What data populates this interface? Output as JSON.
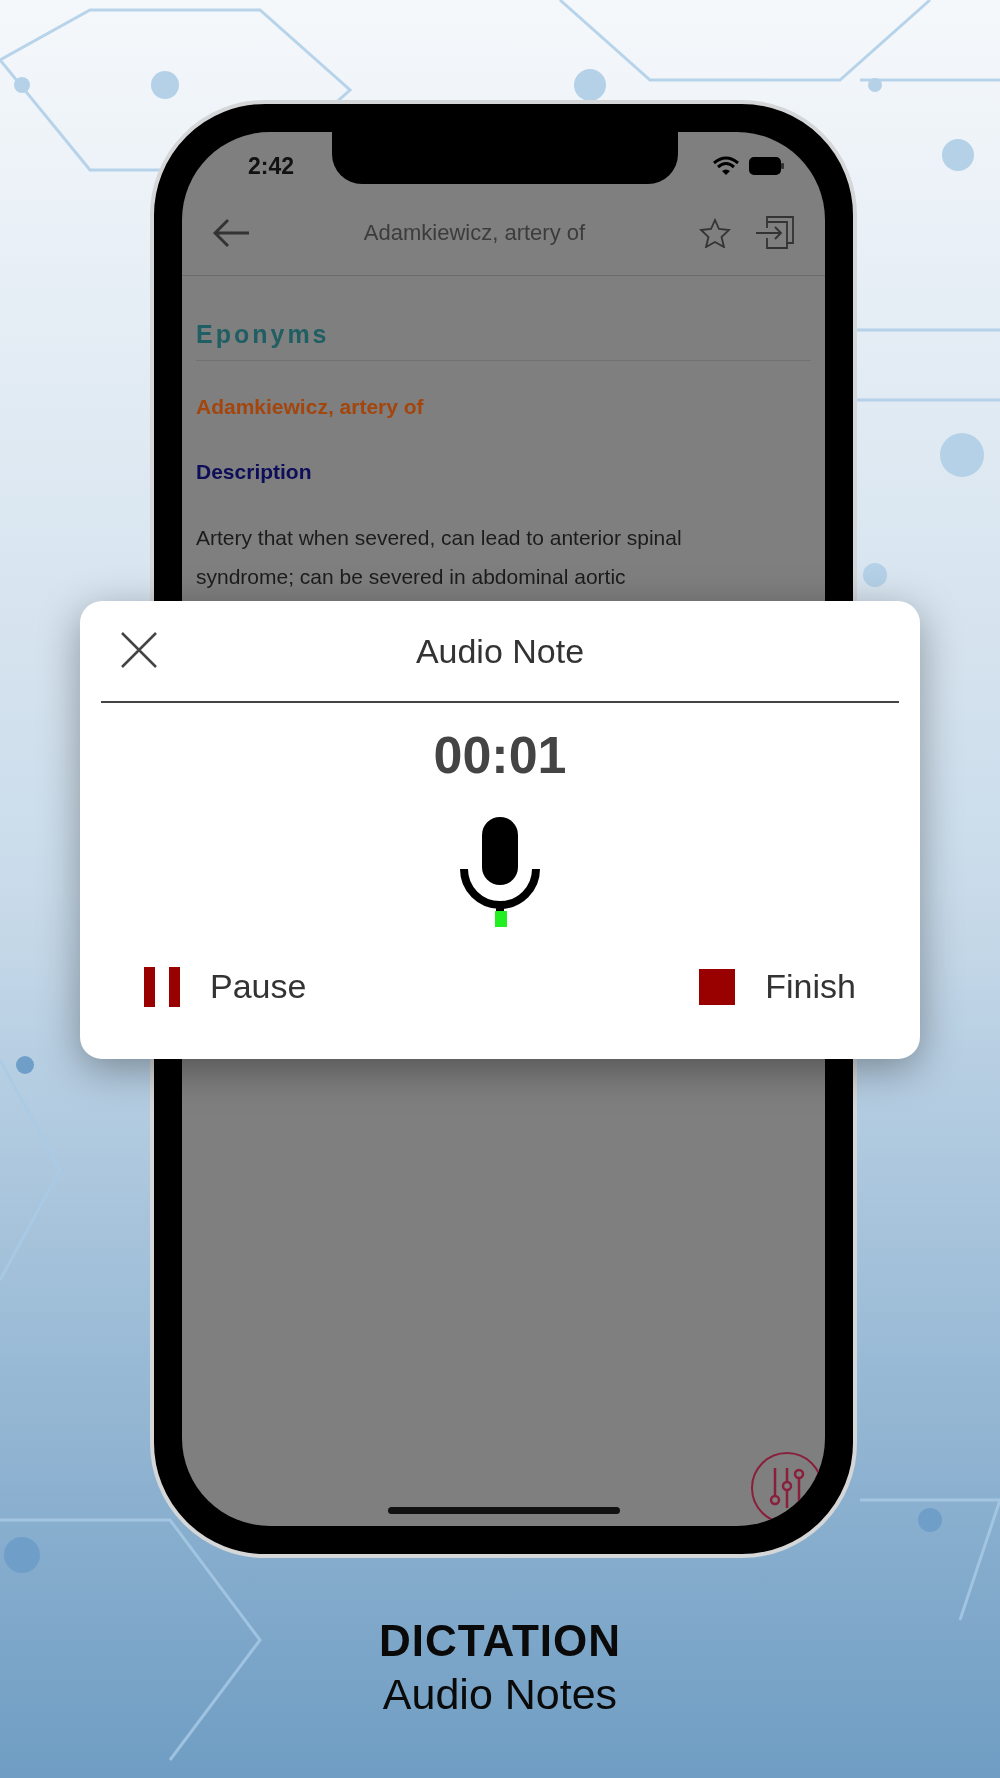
{
  "status_bar": {
    "time": "2:42"
  },
  "nav_bar": {
    "title": "Adamkiewicz, artery of"
  },
  "content": {
    "section": "Eponyms",
    "entry_title": "Adamkiewicz, artery of",
    "subheading": "Description",
    "body": "Artery that when severed, can lead to anterior spinal syndrome; can be severed in abdominal aortic"
  },
  "audio_note": {
    "title": "Audio Note",
    "timer": "00:01",
    "actions": [
      {
        "label": "Pause",
        "kind": "pause"
      },
      {
        "label": "Finish",
        "kind": "finish"
      }
    ]
  },
  "caption": {
    "heading": "DICTATION",
    "subtitle": "Audio Notes"
  }
}
